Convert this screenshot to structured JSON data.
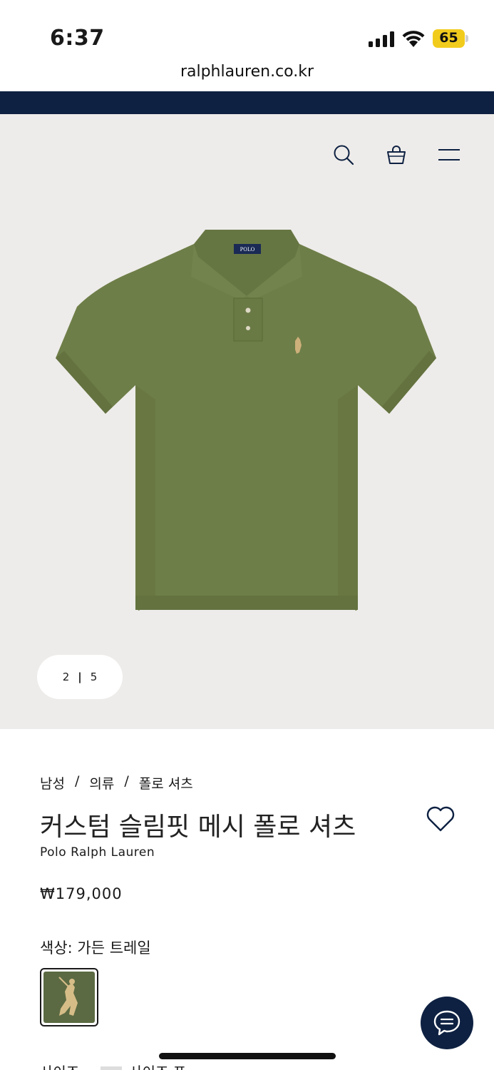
{
  "status_bar": {
    "time": "6:37",
    "battery": "65"
  },
  "browser": {
    "url": "ralphlauren.co.kr"
  },
  "promo": {
    "text": ""
  },
  "gallery": {
    "current": "2",
    "total": "5",
    "shirt_color": "#6e7e48"
  },
  "breadcrumb": [
    "남성",
    "의류",
    "폴로 셔츠"
  ],
  "product": {
    "title": "커스텀 슬림핏 메시 폴로 셔츠",
    "brand": "Polo Ralph Lauren",
    "price": "₩179,000",
    "color_label": "색상: 가든 트레일"
  },
  "size": {
    "label": "사이즈",
    "guide": "사이즈 표"
  },
  "colors": {
    "navy": "#0e2142",
    "gallery_bg": "#eeecea",
    "swatch": "#5b6a42"
  }
}
